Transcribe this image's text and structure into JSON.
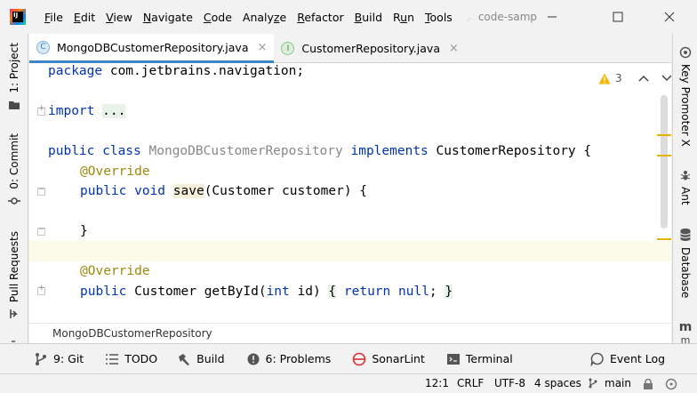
{
  "menu": [
    "File",
    "Edit",
    "View",
    "Navigate",
    "Code",
    "Analyze",
    "Refactor",
    "Build",
    "Run",
    "Tools"
  ],
  "menu_underline": [
    "F",
    "E",
    "V",
    "N",
    "C",
    "z",
    "R",
    "B",
    "u",
    "T"
  ],
  "project_title": "code-sample",
  "logo_text": "IJ",
  "left_tabs": [
    {
      "label": "1: Project",
      "icon": "folder-icon"
    },
    {
      "label": "0: Commit",
      "icon": "commit-icon"
    },
    {
      "label": "Pull Requests",
      "icon": "pull-request-icon"
    }
  ],
  "right_tabs": [
    {
      "label": "Key Promoter X",
      "icon": "key-promoter-icon"
    },
    {
      "label": "Ant",
      "icon": "ant-icon"
    },
    {
      "label": "Database",
      "icon": "database-icon"
    },
    {
      "label": "m",
      "icon": "maven-icon"
    }
  ],
  "editor_tabs": [
    {
      "label": "MongoDBCustomerRepository.java",
      "icon_letter": "C",
      "active": true
    },
    {
      "label": "CustomerRepository.java",
      "icon_letter": "I",
      "active": false
    }
  ],
  "inspection": {
    "count": "3"
  },
  "code": {
    "l1_kw": "package",
    "l1_rest": " com.jetbrains.navigation;",
    "l2_kw": "import",
    "l2_fold": "...",
    "l3_kw": "public class",
    "l3_class": "MongoDBCustomerRepository",
    "l3_impl": "implements",
    "l3_rest": " CustomerRepository {",
    "l4_ann": "@Override",
    "l5_kw": "public void",
    "l5_method": "save",
    "l5_rest": "(Customer customer) {",
    "l6_brace": "}",
    "l7_ann": "@Override",
    "l8_kw": "public",
    "l8_type": " Customer ",
    "l8_method": "getById",
    "l8_p1": "(",
    "l8_int": "int",
    "l8_p2": " id) ",
    "l8_ob": "{",
    "l8_return": "return",
    "l8_null": "null",
    "l8_semi": ";",
    "l8_cb": "}"
  },
  "breadcrumb": "MongoDBCustomerRepository",
  "bottom_tools": [
    {
      "label": "9: Git",
      "icon": "git-icon"
    },
    {
      "label": "TODO",
      "icon": "todo-icon"
    },
    {
      "label": "Build",
      "icon": "build-hammer-icon"
    },
    {
      "label": "6: Problems",
      "icon": "problems-icon"
    },
    {
      "label": "SonarLint",
      "icon": "sonarlint-icon"
    },
    {
      "label": "Terminal",
      "icon": "terminal-icon"
    },
    {
      "label": "Event Log",
      "icon": "event-log-icon"
    }
  ],
  "status": {
    "position": "12:1",
    "line_sep": "CRLF",
    "encoding": "UTF-8",
    "indent": "4 spaces",
    "branch": "main"
  },
  "colors": {
    "keyword": "#0033b3",
    "annotation": "#9e880d",
    "active_tab_underline": "#4083c9",
    "warning": "#e2b400"
  }
}
